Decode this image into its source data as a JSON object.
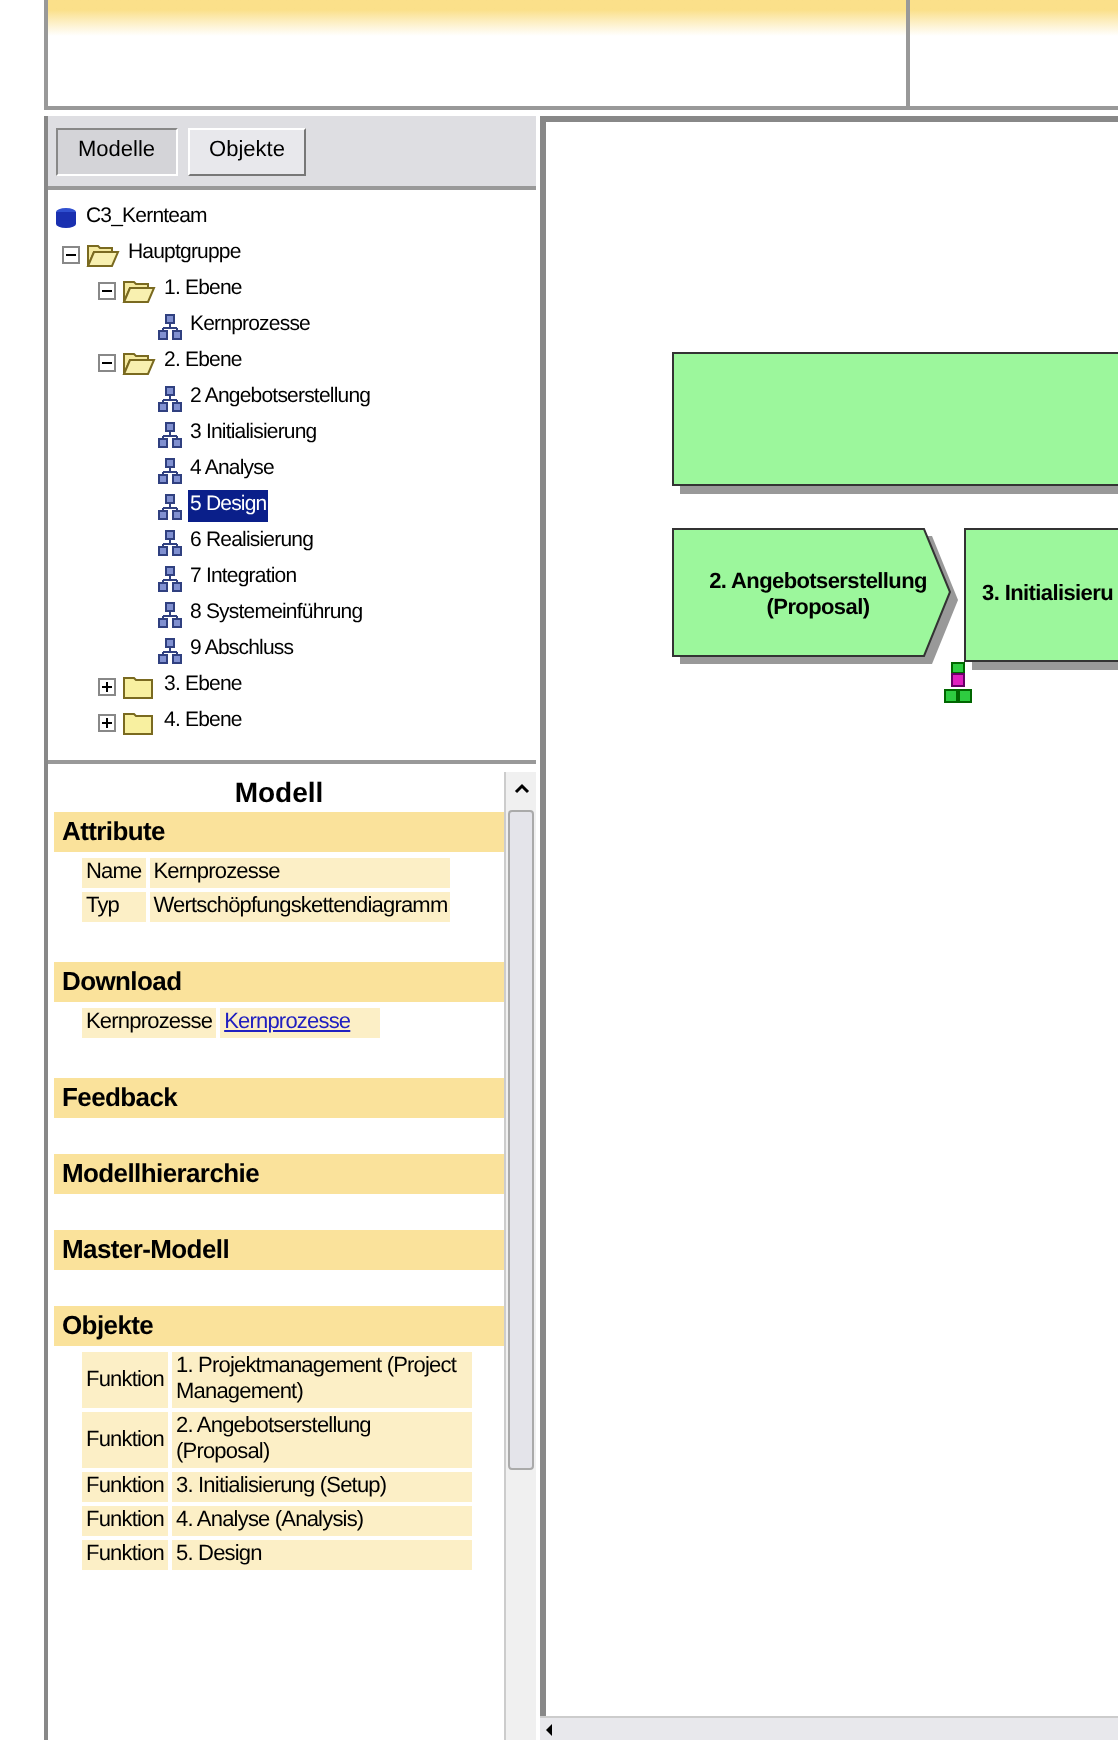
{
  "tabs": [
    {
      "label": "Modelle",
      "selected": true
    },
    {
      "label": "Objekte",
      "selected": false
    }
  ],
  "tree": [
    {
      "label": "C3_Kernteam",
      "kind": "database",
      "selected": false,
      "children": [
        {
          "label": "Hauptgruppe",
          "kind": "folder",
          "expanded": true,
          "selected": false,
          "children": [
            {
              "label": "1. Ebene",
              "kind": "folder",
              "expanded": true,
              "selected": false,
              "children": [
                {
                  "label": "Kernprozesse",
                  "kind": "model",
                  "selected": false
                }
              ]
            },
            {
              "label": "2. Ebene",
              "kind": "folder",
              "expanded": true,
              "selected": false,
              "children": [
                {
                  "label": "2 Angebotserstellung",
                  "kind": "model",
                  "selected": false
                },
                {
                  "label": "3 Initialisierung",
                  "kind": "model",
                  "selected": false
                },
                {
                  "label": "4 Analyse",
                  "kind": "model",
                  "selected": false
                },
                {
                  "label": "5 Design",
                  "kind": "model",
                  "selected": true
                },
                {
                  "label": "6 Realisierung",
                  "kind": "model",
                  "selected": false
                },
                {
                  "label": "7 Integration",
                  "kind": "model",
                  "selected": false
                },
                {
                  "label": "8 Systemeinführung",
                  "kind": "model",
                  "selected": false
                },
                {
                  "label": "9 Abschluss",
                  "kind": "model",
                  "selected": false
                }
              ]
            },
            {
              "label": "3. Ebene",
              "kind": "folder",
              "expanded": false,
              "selected": false
            },
            {
              "label": "4. Ebene",
              "kind": "folder",
              "expanded": false,
              "selected": false
            }
          ]
        }
      ]
    }
  ],
  "details": {
    "title": "Modell",
    "sections": [
      {
        "heading": "Attribute",
        "rows": [
          {
            "label": "Name",
            "value": "Kernprozesse",
            "kind": "text"
          },
          {
            "label": "Typ",
            "value": "Wertschöpfungskettendiagramm",
            "kind": "text"
          }
        ]
      },
      {
        "heading": "Download",
        "rows": [
          {
            "label": "Kernprozesse",
            "value": "Kernprozesse",
            "kind": "link"
          }
        ]
      },
      {
        "heading": "Feedback"
      },
      {
        "heading": "Modellhierarchie"
      },
      {
        "heading": "Master-Modell"
      },
      {
        "heading": "Objekte",
        "rows": [
          {
            "label": "Funktion",
            "value": "1. Projektmanagement (Project Management)",
            "kind": "text"
          },
          {
            "label": "Funktion",
            "value": "2. Angebotserstellung (Proposal)",
            "kind": "text"
          },
          {
            "label": "Funktion",
            "value": "3. Initialisierung (Setup)",
            "kind": "text"
          },
          {
            "label": "Funktion",
            "value": "4. Analyse (Analysis)",
            "kind": "text"
          },
          {
            "label": "Funktion",
            "value": "5. Design",
            "kind": "text"
          }
        ]
      }
    ]
  },
  "diagram": {
    "nodes": [
      {
        "kind": "function"
      },
      {
        "kind": "value_chain",
        "label": "2. Angebotserstellung (Proposal)"
      },
      {
        "kind": "function",
        "label": "3. Initialisieru"
      }
    ]
  }
}
